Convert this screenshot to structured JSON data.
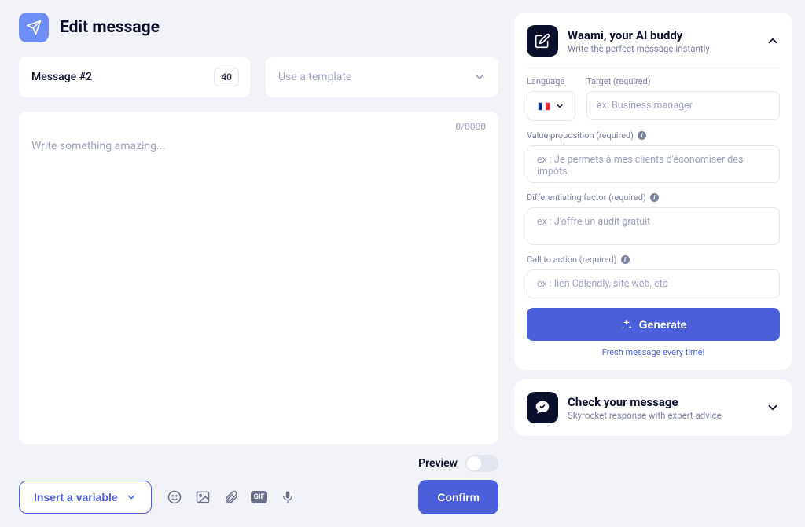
{
  "header": {
    "title": "Edit message"
  },
  "message": {
    "name": "Message #2",
    "counter": "40"
  },
  "template": {
    "placeholder": "Use a template"
  },
  "editor": {
    "placeholder": "Write something amazing...",
    "counter": "0/8000"
  },
  "preview": {
    "label": "Preview"
  },
  "toolbar": {
    "insert_variable": "Insert a variable",
    "confirm": "Confirm"
  },
  "waami": {
    "title": "Waami, your AI buddy",
    "subtitle": "Write the perfect message instantly",
    "labels": {
      "language": "Language",
      "target": "Target (required)",
      "value_prop": "Value proposition (required)",
      "diff_factor": "Differentiating factor (required)",
      "cta": "Call to action (required)"
    },
    "placeholders": {
      "target": "ex: Business manager",
      "value_prop": "ex : Je permets à mes clients d'économiser des impôts",
      "diff_factor": "ex : J'offre un audit gratuit",
      "cta": "ex : lien Calendly, site web, etc"
    },
    "generate": "Generate",
    "fresh": "Fresh message every time!"
  },
  "check": {
    "title": "Check your message",
    "subtitle": "Skyrocket response with expert advice"
  }
}
